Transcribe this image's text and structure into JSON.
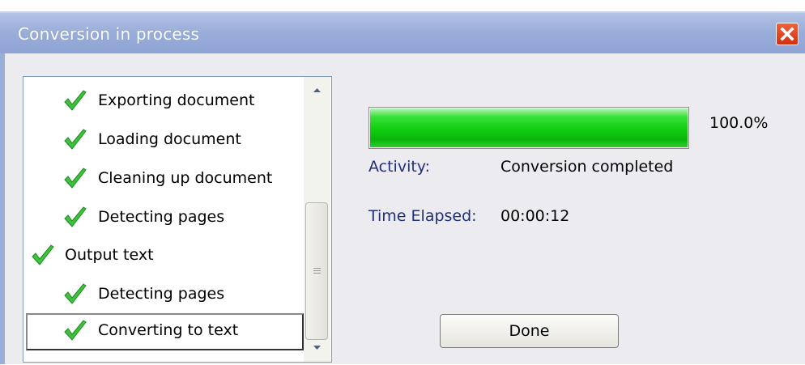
{
  "window": {
    "title": "Conversion in process"
  },
  "steps": [
    {
      "label": "Exporting document",
      "level": 2,
      "status": "complete"
    },
    {
      "label": "Loading document",
      "level": 2,
      "status": "complete"
    },
    {
      "label": "Cleaning up document",
      "level": 2,
      "status": "complete"
    },
    {
      "label": "Detecting pages",
      "level": 2,
      "status": "complete"
    },
    {
      "label": "Output text",
      "level": 1,
      "status": "complete"
    },
    {
      "label": "Detecting pages",
      "level": 2,
      "status": "complete"
    },
    {
      "label": "Converting to text",
      "level": 2,
      "status": "complete",
      "selected": true
    }
  ],
  "progress": {
    "fraction": 1.0,
    "percent_text": "100.0%"
  },
  "details": {
    "activity_label": "Activity:",
    "activity_value": "Conversion completed",
    "elapsed_label": "Time Elapsed:",
    "elapsed_value": "00:00:12"
  },
  "buttons": {
    "done_label": "Done"
  },
  "icons": {
    "close": "close-icon",
    "check": "checkmark-icon",
    "scroll_up": "scroll-up-arrow-icon",
    "scroll_down": "scroll-down-arrow-icon"
  },
  "colors": {
    "titlebar": "#9aaeda",
    "progress_fill": "#10cc10",
    "close_button": "#d2300f",
    "label_text": "#1f2f7a"
  }
}
